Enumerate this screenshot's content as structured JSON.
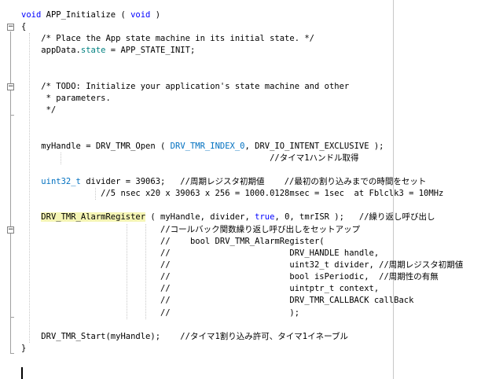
{
  "editor": {
    "lines": [
      {
        "indent": "",
        "tokens": [
          {
            "t": "void",
            "c": "kw"
          },
          {
            "t": " APP_Initialize ( ",
            "c": ""
          },
          {
            "t": "void",
            "c": "kw"
          },
          {
            "t": " )",
            "c": ""
          }
        ]
      },
      {
        "indent": "",
        "tokens": [
          {
            "t": "{",
            "c": ""
          }
        ]
      },
      {
        "indent": "    ",
        "tokens": [
          {
            "t": "/* Place the App state machine in its initial state. */",
            "c": "cm"
          }
        ]
      },
      {
        "indent": "    ",
        "tokens": [
          {
            "t": "appData.",
            "c": ""
          },
          {
            "t": "state",
            "c": "mb"
          },
          {
            "t": " = APP_STATE_INIT;",
            "c": ""
          }
        ]
      },
      {
        "indent": "",
        "tokens": []
      },
      {
        "indent": "",
        "tokens": []
      },
      {
        "indent": "    ",
        "tokens": [
          {
            "t": "/* TODO: Initialize your application's state machine and other",
            "c": "cm"
          }
        ]
      },
      {
        "indent": "     ",
        "tokens": [
          {
            "t": "* parameters.",
            "c": "cm"
          }
        ]
      },
      {
        "indent": "     ",
        "tokens": [
          {
            "t": "*/",
            "c": "cm"
          }
        ]
      },
      {
        "indent": "",
        "tokens": []
      },
      {
        "indent": "",
        "tokens": []
      },
      {
        "indent": "    ",
        "tokens": [
          {
            "t": "myHandle = DRV_TMR_Open ( ",
            "c": ""
          },
          {
            "t": "DRV_TMR_INDEX_0",
            "c": "en"
          },
          {
            "t": ", DRV_IO_INTENT_EXCLUSIVE );",
            "c": ""
          }
        ]
      },
      {
        "indent": "                                                  ",
        "tokens": [
          {
            "t": "//タイマ1ハンドル取得",
            "c": "cm"
          }
        ]
      },
      {
        "indent": "",
        "tokens": []
      },
      {
        "indent": "    ",
        "tokens": [
          {
            "t": "uint32_t",
            "c": "ty"
          },
          {
            "t": " divider = 39063;   //周期レジスタ初期値    //最初の割り込みまでの時間をセット",
            "c": ""
          }
        ]
      },
      {
        "indent": "                ",
        "tokens": [
          {
            "t": "//5 nsec x20 x 39063 x 256 = 1000.0128msec = 1sec  at Fblclk3 = 10MHz",
            "c": "cm"
          }
        ]
      },
      {
        "indent": "",
        "tokens": []
      },
      {
        "indent": "    ",
        "tokens": [
          {
            "t": "DRV_TMR_AlarmRegister",
            "c": "hl"
          },
          {
            "t": " ( myHandle, divider, ",
            "c": ""
          },
          {
            "t": "true",
            "c": "kw"
          },
          {
            "t": ", 0, tmrISR );   //繰り返し呼び出し",
            "c": ""
          }
        ]
      },
      {
        "indent": "                            ",
        "tokens": [
          {
            "t": "//コールバック関数繰り返し呼び出しをセットアップ",
            "c": "cm"
          }
        ]
      },
      {
        "indent": "                            ",
        "tokens": [
          {
            "t": "//    bool DRV_TMR_AlarmRegister(",
            "c": "cm"
          }
        ]
      },
      {
        "indent": "                            ",
        "tokens": [
          {
            "t": "//                        DRV_HANDLE handle,",
            "c": "cm"
          }
        ]
      },
      {
        "indent": "                            ",
        "tokens": [
          {
            "t": "//                        uint32_t divider, //周期レジスタ初期値",
            "c": "cm"
          }
        ]
      },
      {
        "indent": "                            ",
        "tokens": [
          {
            "t": "//                        bool isPeriodic,  //周期性の有無",
            "c": "cm"
          }
        ]
      },
      {
        "indent": "                            ",
        "tokens": [
          {
            "t": "//                        uintptr_t context,",
            "c": "cm"
          }
        ]
      },
      {
        "indent": "                            ",
        "tokens": [
          {
            "t": "//                        DRV_TMR_CALLBACK callBack",
            "c": "cm"
          }
        ]
      },
      {
        "indent": "                            ",
        "tokens": [
          {
            "t": "//                        );",
            "c": "cm"
          }
        ]
      },
      {
        "indent": "",
        "tokens": []
      },
      {
        "indent": "    ",
        "tokens": [
          {
            "t": "DRV_TMR_Start(myHandle);    //タイマ1割り込み許可、タイマ1イネーブル",
            "c": ""
          }
        ]
      },
      {
        "indent": "",
        "tokens": [
          {
            "t": "}",
            "c": ""
          }
        ]
      }
    ],
    "fold_markers": [
      {
        "line": 1,
        "symbol": "−"
      },
      {
        "line": 6,
        "symbol": "−"
      },
      {
        "line": 18,
        "symbol": "−"
      }
    ]
  }
}
